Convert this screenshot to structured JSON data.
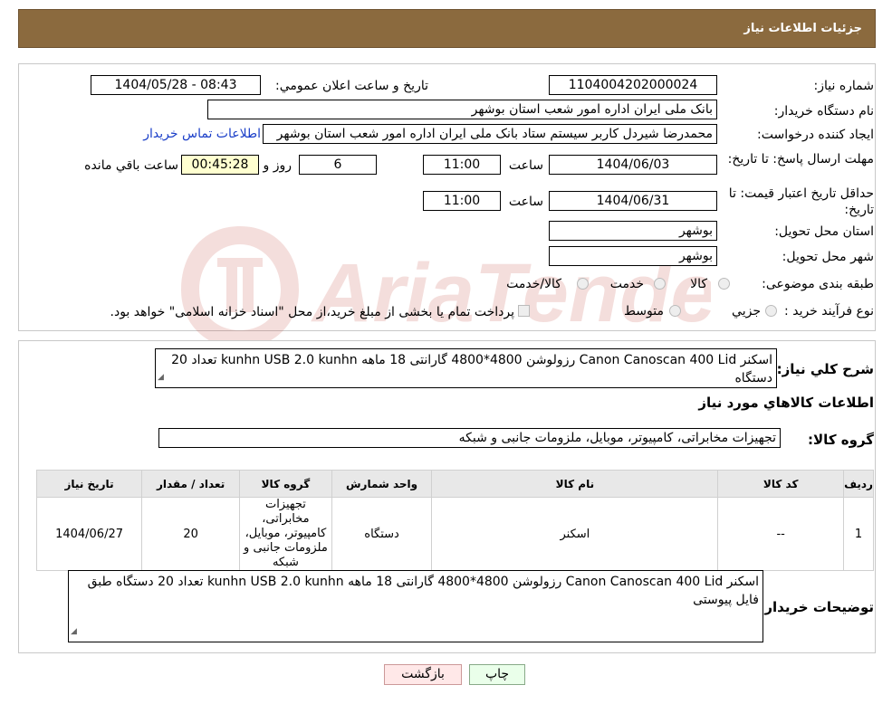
{
  "header": {
    "title": "جزئیات اطلاعات نیاز"
  },
  "watermark": {
    "text": "AriaTender.neT",
    "color": "#c0392b"
  },
  "form": {
    "need_number_label": "شماره نیاز:",
    "need_number": "1104004202000024",
    "announce_label": "تاریخ و ساعت اعلان عمومي:",
    "announce_value": "1404/05/28 - 08:43",
    "buyer_org_label": "نام دستگاه خریدار:",
    "buyer_org": "بانک ملی ایران اداره امور شعب استان بوشهر",
    "creator_label": "ایجاد کننده درخواست:",
    "creator": "محمدرضا شیردل کاربر سیستم ستاد بانک ملی ایران اداره امور شعب استان بوشهر",
    "contact_link": "اطلاعات تماس خریدار",
    "deadline_label": "مهلت ارسال پاسخ: تا تاریخ:",
    "deadline_date": "1404/06/03",
    "time_label": "ساعت",
    "deadline_time": "11:00",
    "days": "6",
    "days_label": "روز و",
    "remaining": "00:45:28",
    "remaining_label": "ساعت باقي مانده",
    "validity_label": "حداقل تاریخ اعتبار قیمت: تا تاریخ:",
    "validity_date": "1404/06/31",
    "validity_time": "11:00",
    "province_label": "استان محل تحویل:",
    "province": "بوشهر",
    "city_label": "شهر محل تحویل:",
    "city": "بوشهر",
    "category_label": "طبقه بندی موضوعی:",
    "category_options": [
      "کالا",
      "خدمت",
      "کالا/خدمت"
    ],
    "process_label": "نوع فرآیند خرید :",
    "process_options": [
      "جزيي",
      "متوسط"
    ],
    "process_note": "پرداخت تمام یا بخشی از مبلغ خرید،از محل \"اسناد خزانه اسلامی\" خواهد بود."
  },
  "summary": {
    "label": "شرح کلي نياز:",
    "text": "اسکنر Canon Canoscan 400 Lid  رزولوشن 4800*4800 گارانتی 18 ماهه  kunhn   USB 2.0 kunhn  تعداد 20 دستگاه",
    "goods_title": "اطلاعات کالاهاي مورد نياز",
    "group_label": "گروه کالا:",
    "group_value": "تجهیزات مخابراتی، کامپیوتر، موبایل، ملزومات جانبی و شبکه"
  },
  "table": {
    "headers": [
      "رديف",
      "کد کالا",
      "نام کالا",
      "واحد شمارش",
      "گروه کالا",
      "تعداد / مقدار",
      "تاريخ نياز"
    ],
    "rows": [
      [
        "1",
        "--",
        "اسکنر",
        "دستگاه",
        "تجهیزات مخابراتی، کامپیوتر، موبایل، ملزومات جانبی و شبکه",
        "20",
        "1404/06/27"
      ]
    ]
  },
  "buyer_notes": {
    "label": "توضيحات خريدار:",
    "text": "اسکنر Canon Canoscan 400 Lid  رزولوشن 4800*4800 گارانتی 18 ماهه  kunhn   USB 2.0 kunhn  تعداد 20 دستگاه طبق فایل پیوستی"
  },
  "buttons": {
    "print": "چاپ",
    "back": "بازگشت"
  }
}
